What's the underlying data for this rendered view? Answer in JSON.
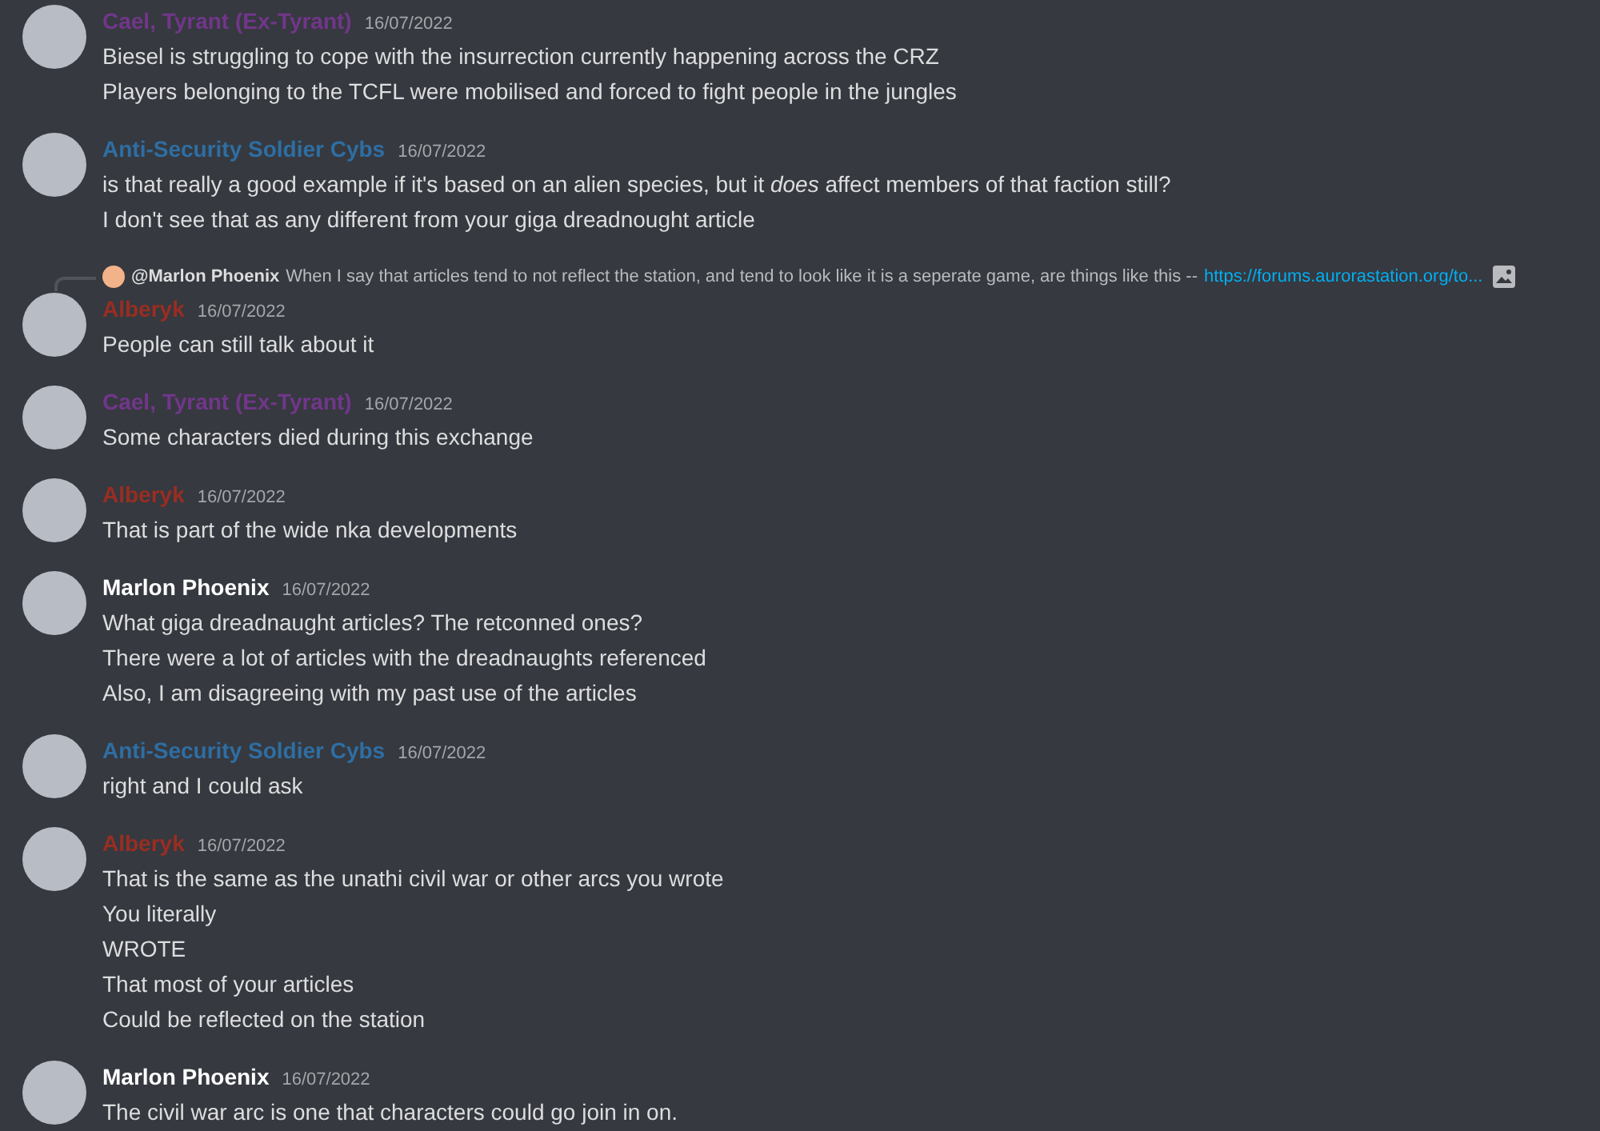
{
  "messages": [
    {
      "author": "Cael, Tyrant (Ex-Tyrant)",
      "color": "#71368a",
      "date": "16/07/2022",
      "lines": [
        "Biesel is struggling to cope with the insurrection currently happening across the CRZ",
        "Players belonging to the TCFL were mobilised and forced to fight people in the jungles"
      ]
    },
    {
      "author": "Anti-Security Soldier Cybs",
      "color": "#2e6ea3",
      "date": "16/07/2022",
      "lines": [
        "is that really a good example if it's based on an alien species, but it *does* affect members of that faction still?",
        "I don't see that as any different from your giga dreadnought article"
      ]
    },
    {
      "author": "Alberyk",
      "color": "#992d22",
      "date": "16/07/2022",
      "reply": {
        "author": "@Marlon Phoenix",
        "text": "When I say that articles tend to not reflect the station, and tend to look like it is a seperate game, are things like this --",
        "link": "https://forums.aurorastation.org/to..."
      },
      "lines": [
        "People can still talk about it"
      ]
    },
    {
      "author": "Cael, Tyrant (Ex-Tyrant)",
      "color": "#71368a",
      "date": "16/07/2022",
      "lines": [
        "Some characters died during this exchange"
      ]
    },
    {
      "author": "Alberyk",
      "color": "#992d22",
      "date": "16/07/2022",
      "lines": [
        "That is part of the wide nka developments"
      ]
    },
    {
      "author": "Marlon Phoenix",
      "color": "#ffffff",
      "date": "16/07/2022",
      "lines": [
        "What giga dreadnaught articles? The retconned ones?",
        "There were a lot of articles with the dreadnaughts referenced",
        "Also, I am disagreeing with my past use of the articles"
      ]
    },
    {
      "author": "Anti-Security Soldier Cybs",
      "color": "#2e6ea3",
      "date": "16/07/2022",
      "lines": [
        "right and I could ask"
      ]
    },
    {
      "author": "Alberyk",
      "color": "#992d22",
      "date": "16/07/2022",
      "lines": [
        "That is the same as the unathi civil war or other arcs you wrote",
        "You literally",
        "WROTE",
        "That most of your articles",
        "Could be reflected on the station"
      ]
    },
    {
      "author": "Marlon Phoenix",
      "color": "#ffffff",
      "date": "16/07/2022",
      "lines": [
        "The civil war arc is one that characters could go join in on."
      ]
    }
  ]
}
